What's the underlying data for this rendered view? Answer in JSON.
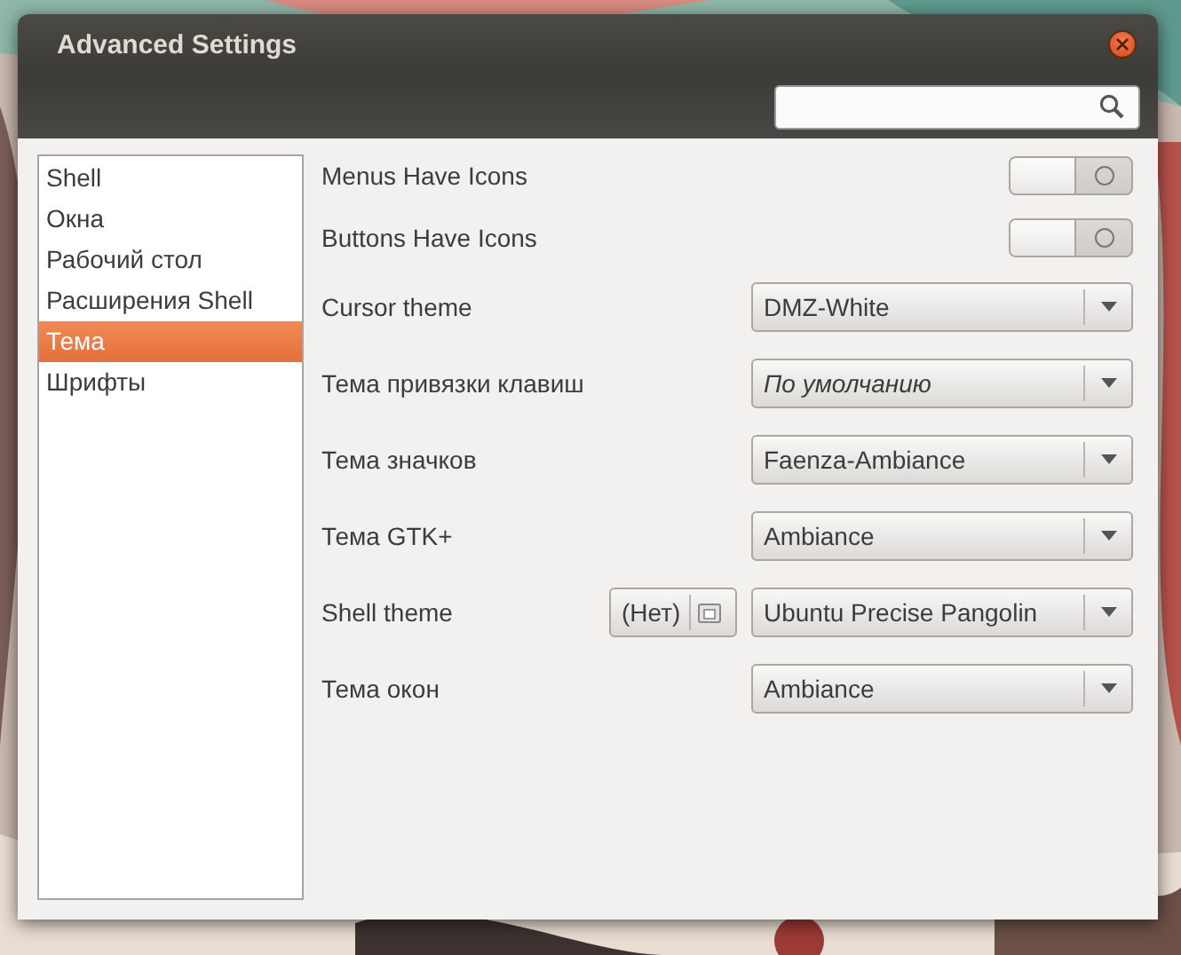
{
  "window": {
    "title": "Advanced Settings"
  },
  "sidebar": {
    "items": [
      {
        "label": "Shell",
        "selected": false
      },
      {
        "label": "Окна",
        "selected": false
      },
      {
        "label": "Рабочий стол",
        "selected": false
      },
      {
        "label": "Расширения Shell",
        "selected": false
      },
      {
        "label": "Тема",
        "selected": true
      },
      {
        "label": "Шрифты",
        "selected": false
      }
    ]
  },
  "settings": [
    {
      "kind": "toggle",
      "label": "Menus Have Icons",
      "on": false
    },
    {
      "kind": "toggle",
      "label": "Buttons Have Icons",
      "on": false
    },
    {
      "kind": "combo",
      "label": "Cursor theme",
      "value": "DMZ-White",
      "italic": false
    },
    {
      "kind": "combo",
      "label": "Тема привязки клавиш",
      "value": "По умолчанию",
      "italic": true
    },
    {
      "kind": "combo",
      "label": "Тема значков",
      "value": "Faenza-Ambiance",
      "italic": false
    },
    {
      "kind": "combo",
      "label": "Тема GTK+",
      "value": "Ambiance",
      "italic": false
    },
    {
      "kind": "file-combo",
      "label": "Shell theme",
      "file": "(Нет)",
      "value": "Ubuntu Precise Pangolin",
      "italic": false
    },
    {
      "kind": "combo",
      "label": "Тема окон",
      "value": "Ambiance",
      "italic": false
    }
  ]
}
